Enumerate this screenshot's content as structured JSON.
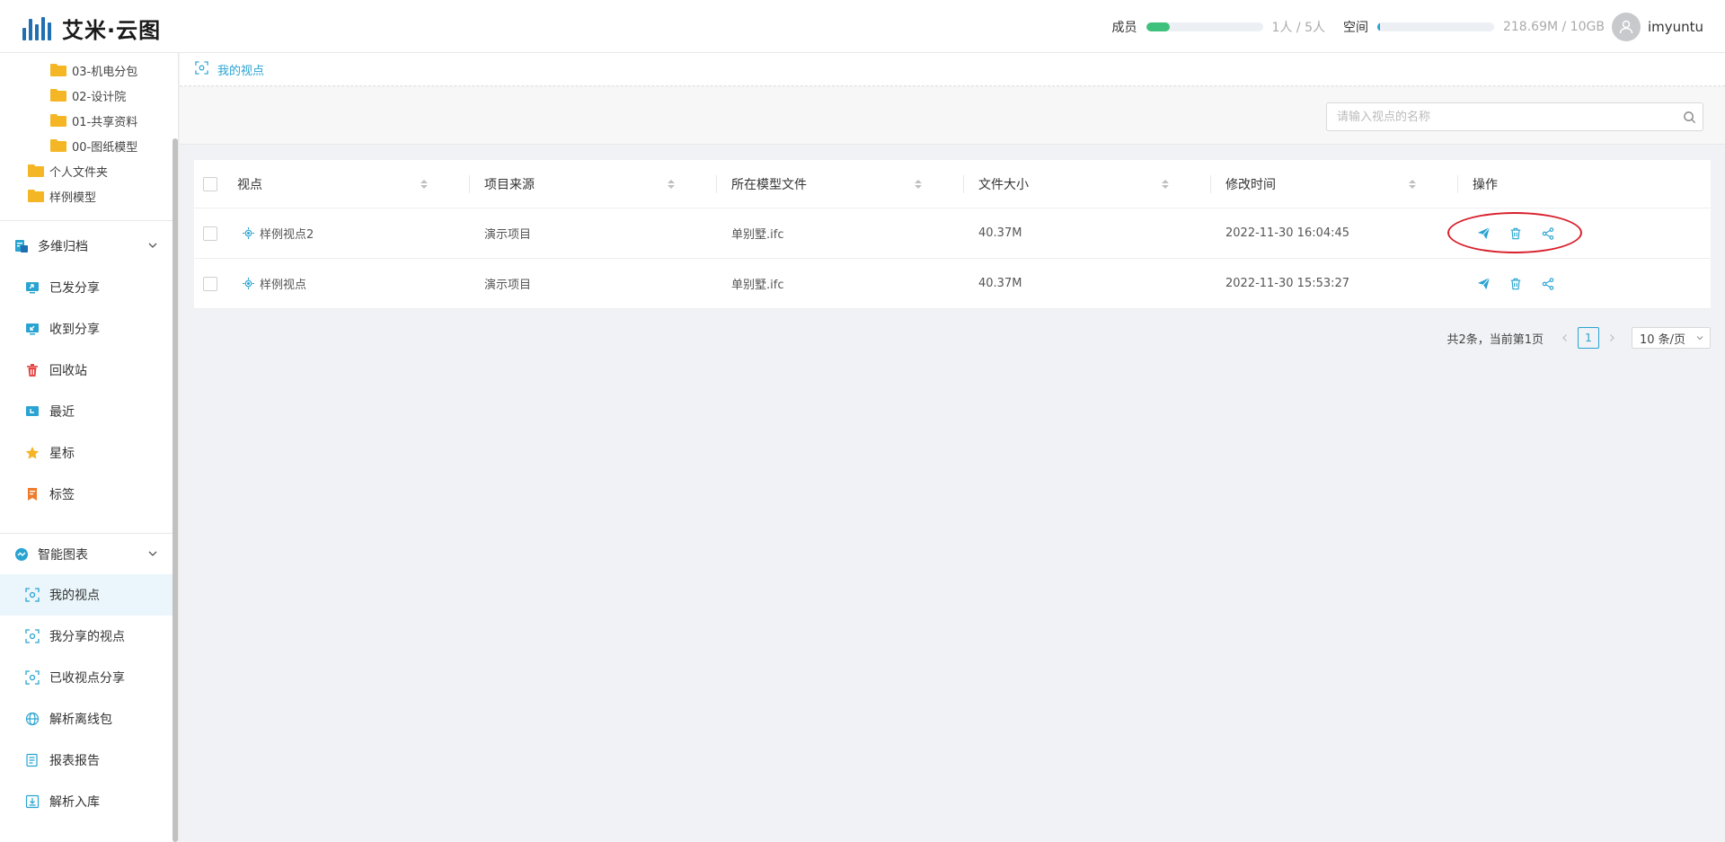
{
  "app": {
    "logo_text": "艾米·云图"
  },
  "header": {
    "members_label": "成员",
    "members_count": "1人 / 5人",
    "members_fraction": 0.2,
    "space_label": "空间",
    "space_count": "218.69M / 10GB",
    "space_fraction": 0.02,
    "username": "imyuntu"
  },
  "sidebar": {
    "folders": [
      {
        "label": "03-机电分包",
        "level": 2
      },
      {
        "label": "02-设计院",
        "level": 2
      },
      {
        "label": "01-共享资料",
        "level": 2
      },
      {
        "label": "00-图纸模型",
        "level": 2
      },
      {
        "label": "个人文件夹",
        "level": 1
      },
      {
        "label": "样例模型",
        "level": 1
      }
    ],
    "group1": {
      "label": "多维归档",
      "items": [
        {
          "label": "已发分享",
          "icon": "share-sent-icon"
        },
        {
          "label": "收到分享",
          "icon": "share-received-icon"
        },
        {
          "label": "回收站",
          "icon": "trash-icon"
        },
        {
          "label": "最近",
          "icon": "recent-icon"
        },
        {
          "label": "星标",
          "icon": "star-icon"
        },
        {
          "label": "标签",
          "icon": "tag-icon"
        }
      ]
    },
    "group2": {
      "label": "智能图表",
      "items": [
        {
          "label": "我的视点",
          "icon": "viewpoint-icon",
          "active": true
        },
        {
          "label": "我分享的视点",
          "icon": "viewpoint-share-icon"
        },
        {
          "label": "已收视点分享",
          "icon": "viewpoint-received-icon"
        },
        {
          "label": "解析离线包",
          "icon": "globe-icon"
        },
        {
          "label": "报表报告",
          "icon": "report-icon"
        },
        {
          "label": "解析入库",
          "icon": "import-icon"
        }
      ]
    }
  },
  "breadcrumb": {
    "label": "我的视点"
  },
  "search": {
    "placeholder": "请输入视点的名称",
    "value": ""
  },
  "table": {
    "columns": [
      "视点",
      "项目来源",
      "所在模型文件",
      "文件大小",
      "修改时间",
      "操作"
    ],
    "rows": [
      {
        "name": "样例视点2",
        "project": "演示项目",
        "model": "单别墅.ifc",
        "size": "40.37M",
        "modified": "2022-11-30 16:04:45"
      },
      {
        "name": "样例视点",
        "project": "演示项目",
        "model": "单别墅.ifc",
        "size": "40.37M",
        "modified": "2022-11-30 15:53:27"
      }
    ]
  },
  "pagination": {
    "summary": "共2条，当前第1页",
    "current_page": "1",
    "page_size": "10 条/页"
  },
  "colors": {
    "accent": "#29a3d1",
    "members_bar": "#3ec17d",
    "space_bar": "#29a3d1",
    "highlight": "#d9202c"
  }
}
